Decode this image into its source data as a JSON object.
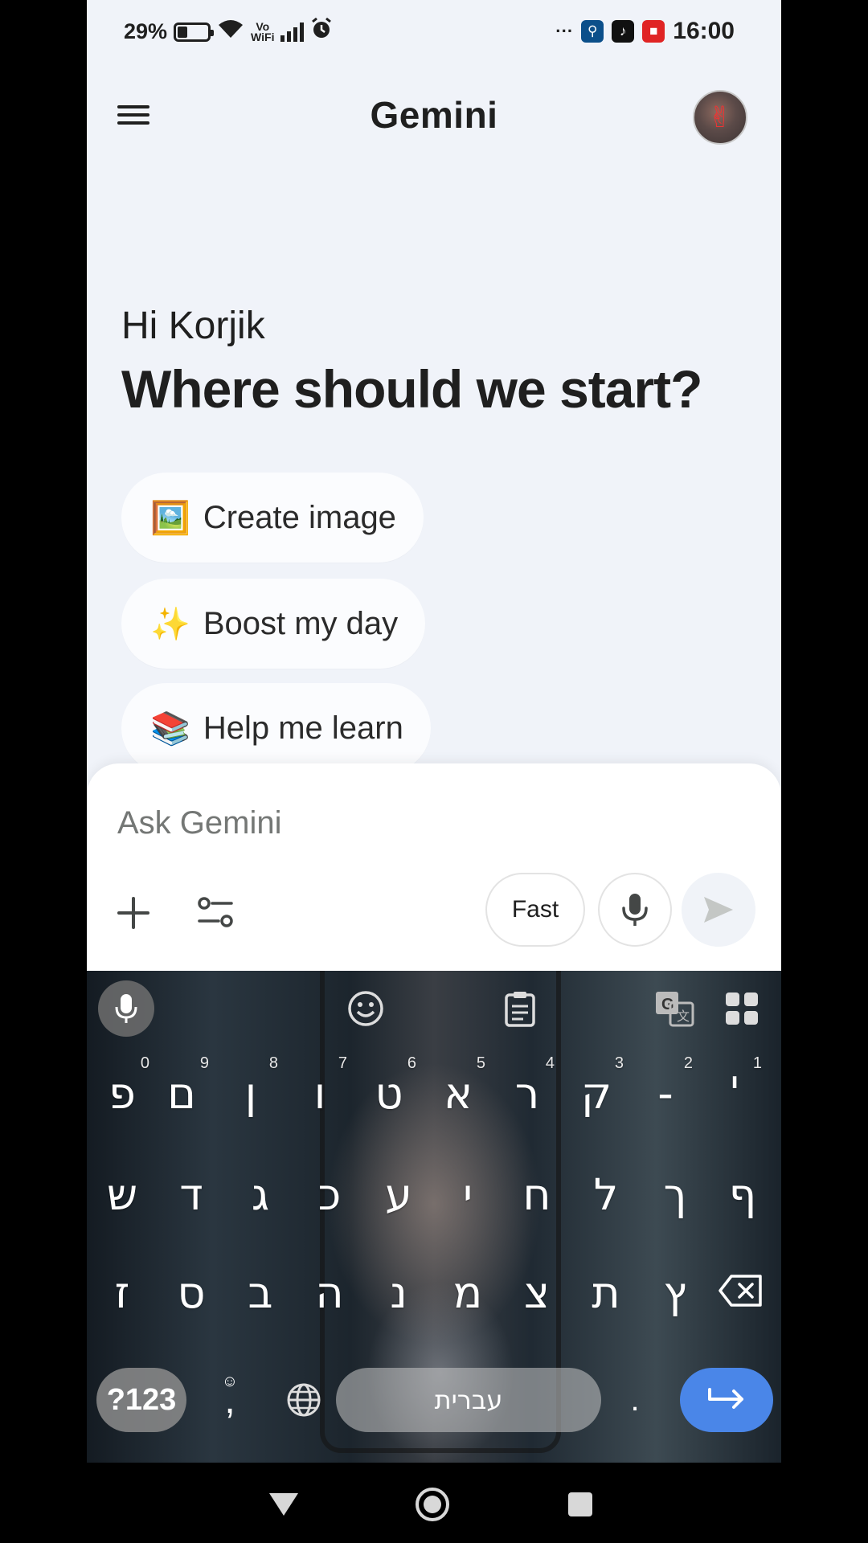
{
  "status_bar": {
    "battery_percent": "29%",
    "battery_level": 0.29,
    "vowifi_line1": "Vo",
    "vowifi_line2": "WiFi",
    "overflow": "···",
    "time": "16:00",
    "icons": [
      "battery-icon",
      "wifi-icon",
      "vowifi-icon",
      "signal-icon",
      "alarm-icon",
      "accessibility-app-icon",
      "tiktok-icon",
      "screen-record-icon"
    ]
  },
  "header": {
    "title": "Gemini",
    "avatar_emoji": "✌"
  },
  "greeting": {
    "hello": "Hi Korjik",
    "headline": "Where should we start?"
  },
  "suggestions": [
    {
      "emoji": "🖼️",
      "label": "Create image"
    },
    {
      "emoji": "✨",
      "label": "Boost my day"
    },
    {
      "emoji": "📚",
      "label": "Help me learn"
    }
  ],
  "input": {
    "placeholder": "Ask Gemini",
    "value": "",
    "mode_label": "Fast"
  },
  "keyboard": {
    "row1": [
      {
        "char": "'",
        "num": "1"
      },
      {
        "char": "-",
        "num": "2"
      },
      {
        "char": "ק",
        "num": "3"
      },
      {
        "char": "ר",
        "num": "4"
      },
      {
        "char": "א",
        "num": "5"
      },
      {
        "char": "ט",
        "num": "6"
      },
      {
        "char": "ו",
        "num": "7"
      },
      {
        "char": "ן",
        "num": "8"
      },
      {
        "char": "ם",
        "num": "9"
      },
      {
        "char": "פ",
        "num": "0"
      }
    ],
    "row2": [
      "ש",
      "ד",
      "ג",
      "כ",
      "ע",
      "י",
      "ח",
      "ל",
      "ך",
      "ף"
    ],
    "row3": [
      "ז",
      "ס",
      "ב",
      "ה",
      "נ",
      "מ",
      "צ",
      "ת",
      "ץ"
    ],
    "symbols_key": "?123",
    "comma_key": ",",
    "comma_sub": "☺",
    "space_label": "עברית",
    "period_key": "."
  },
  "colors": {
    "background": "#f0f3f9",
    "enter_key": "#4a86e8",
    "text": "#1f1f1f"
  }
}
